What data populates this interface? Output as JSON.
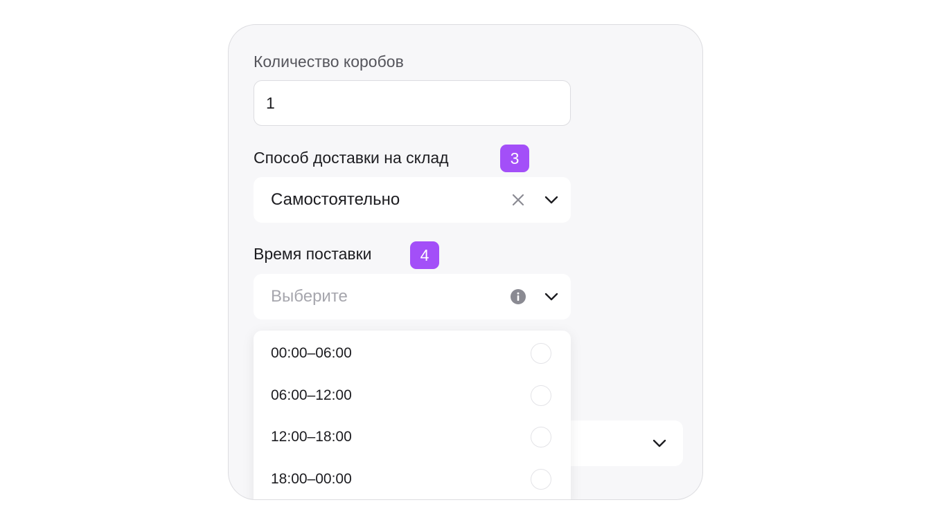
{
  "form": {
    "boxes": {
      "label": "Количество коробов",
      "value": "1"
    },
    "delivery_method": {
      "label": "Способ доставки на склад",
      "badge": "3",
      "value": "Самостоятельно",
      "clear_icon": "close-icon",
      "chevron_icon": "chevron-down-icon"
    },
    "delivery_time": {
      "label": "Время поставки",
      "badge": "4",
      "placeholder": "Выберите",
      "info_icon": "info-icon",
      "chevron_icon": "chevron-down-icon",
      "options": [
        {
          "label": "00:00–06:00",
          "selected": false
        },
        {
          "label": "06:00–12:00",
          "selected": false
        },
        {
          "label": "12:00–18:00",
          "selected": false
        },
        {
          "label": "18:00–00:00",
          "selected": false
        }
      ]
    }
  },
  "colors": {
    "accent": "#a34ff8",
    "card_background": "#f7f7f9",
    "field_background": "#ffffff",
    "text": "#1c1c20",
    "placeholder": "#a6a6ad"
  }
}
